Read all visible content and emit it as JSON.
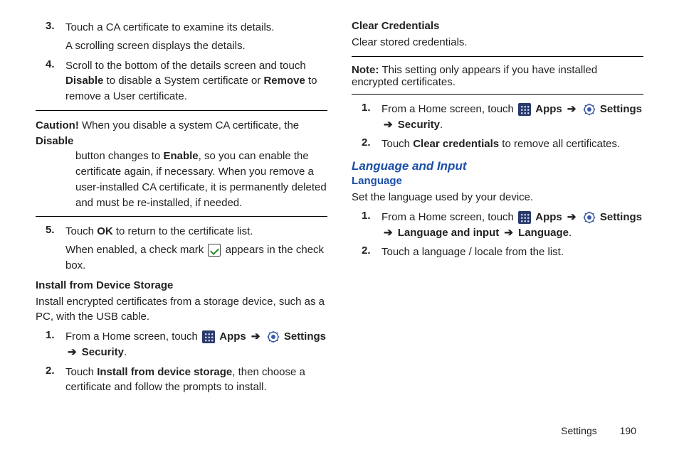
{
  "left": {
    "step3_num": "3.",
    "step3_a": "Touch a CA certificate to examine its details.",
    "step3_b": "A scrolling screen displays the details.",
    "step4_num": "4.",
    "step4_a": "Scroll to the bottom of the details screen and touch ",
    "step4_disable": "Disable",
    "step4_b": " to disable a System certificate or ",
    "step4_remove": "Remove",
    "step4_c": " to remove a User certificate.",
    "caution_label": "Caution! ",
    "caution_a": "When you disable a system CA certificate, the ",
    "caution_disable": "Disable",
    "caution_b": " button changes to ",
    "caution_enable": "Enable",
    "caution_c": ", so you can enable the certificate again, if necessary. When you remove a user-installed CA certificate, it is permanently deleted and must be re-installed, if needed.",
    "step5_num": "5.",
    "step5_a": "Touch ",
    "step5_ok": "OK",
    "step5_b": " to return to the certificate list.",
    "step5_c1": "When enabled, a check mark ",
    "step5_c2": " appears in the check box.",
    "install_heading": "Install from Device Storage",
    "install_para": "Install encrypted certificates from a storage device, such as a PC, with the USB cable.",
    "install1_num": "1.",
    "install1_a": "From a Home screen, touch ",
    "apps_label": "Apps",
    "arrow": "➔",
    "settings_label": "Settings",
    "install1_b": "Security",
    "install2_num": "2.",
    "install2_a": "Touch ",
    "install2_bold": "Install from device storage",
    "install2_b": ", then choose a certificate and follow the prompts to install."
  },
  "right": {
    "clear_heading": "Clear Credentials",
    "clear_para": "Clear stored credentials.",
    "note_label": "Note: ",
    "note_body": "This setting only appears if you have installed encrypted certificates.",
    "r1_num": "1.",
    "r1_a": "From a Home screen, touch ",
    "r1_b": "Security",
    "r2_num": "2.",
    "r2_a": "Touch ",
    "r2_bold": "Clear credentials",
    "r2_b": " to remove all certificates.",
    "section": "Language and Input",
    "sub": "Language",
    "lang_para": "Set the language used by your device.",
    "l1_num": "1.",
    "l1_a": "From a Home screen, touch ",
    "l1_path1": "Language and input",
    "l1_path2": "Language",
    "l2_num": "2.",
    "l2_a": "Touch a language / locale from the list."
  },
  "footer": {
    "section": "Settings",
    "page": "190"
  }
}
